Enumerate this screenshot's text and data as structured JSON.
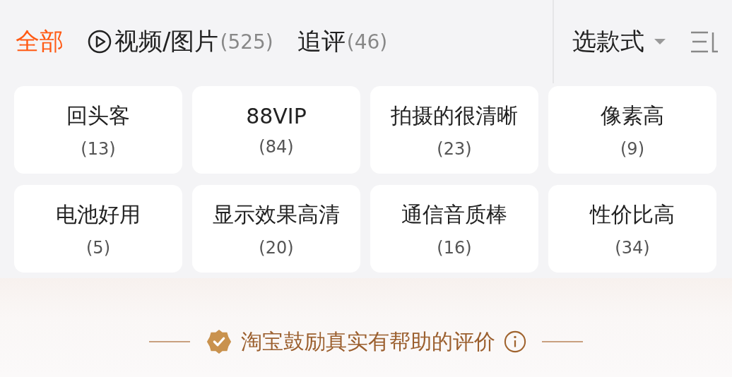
{
  "tabs": [
    {
      "label": "全部",
      "selected": true
    },
    {
      "label": "视频/图片",
      "count": "(525)",
      "kind": "video",
      "selected": false
    },
    {
      "label": "追评",
      "count": "(46)",
      "selected": false
    }
  ],
  "style_filter": {
    "label": "选款式"
  },
  "tags": [
    {
      "label": "回头客",
      "count": "(13)"
    },
    {
      "label": "88VIP",
      "count": "(84)"
    },
    {
      "label": "拍摄的很清晰",
      "count": "(23)"
    },
    {
      "label": "像素高",
      "count": "(9)"
    },
    {
      "label": "电池好用",
      "count": "(5)"
    },
    {
      "label": "显示效果高清",
      "count": "(20)"
    },
    {
      "label": "通信音质棒",
      "count": "(16)"
    },
    {
      "label": "性价比高",
      "count": "(34)"
    }
  ],
  "notice": {
    "text": "淘宝鼓励真实有帮助的评价"
  }
}
